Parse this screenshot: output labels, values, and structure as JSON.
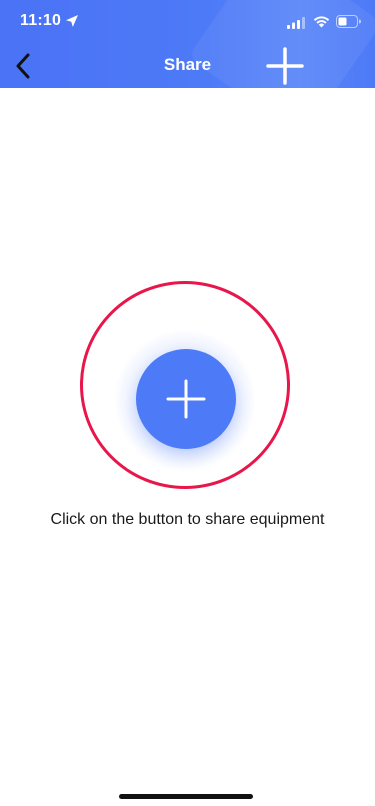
{
  "status_bar": {
    "time": "11:10"
  },
  "nav": {
    "title": "Share"
  },
  "main": {
    "hint": "Click on the button to share equipment"
  },
  "icons": {
    "back": "chevron-left-icon",
    "add_top": "plus-icon",
    "share_button": "plus-icon",
    "location": "location-arrow-icon",
    "signal": "signal-icon",
    "wifi": "wifi-icon",
    "battery": "battery-icon"
  },
  "colors": {
    "header": "#4d7af7",
    "primary_button": "#4d7af7",
    "highlight_ring": "#e8164a",
    "text": "#1a1a1a"
  }
}
